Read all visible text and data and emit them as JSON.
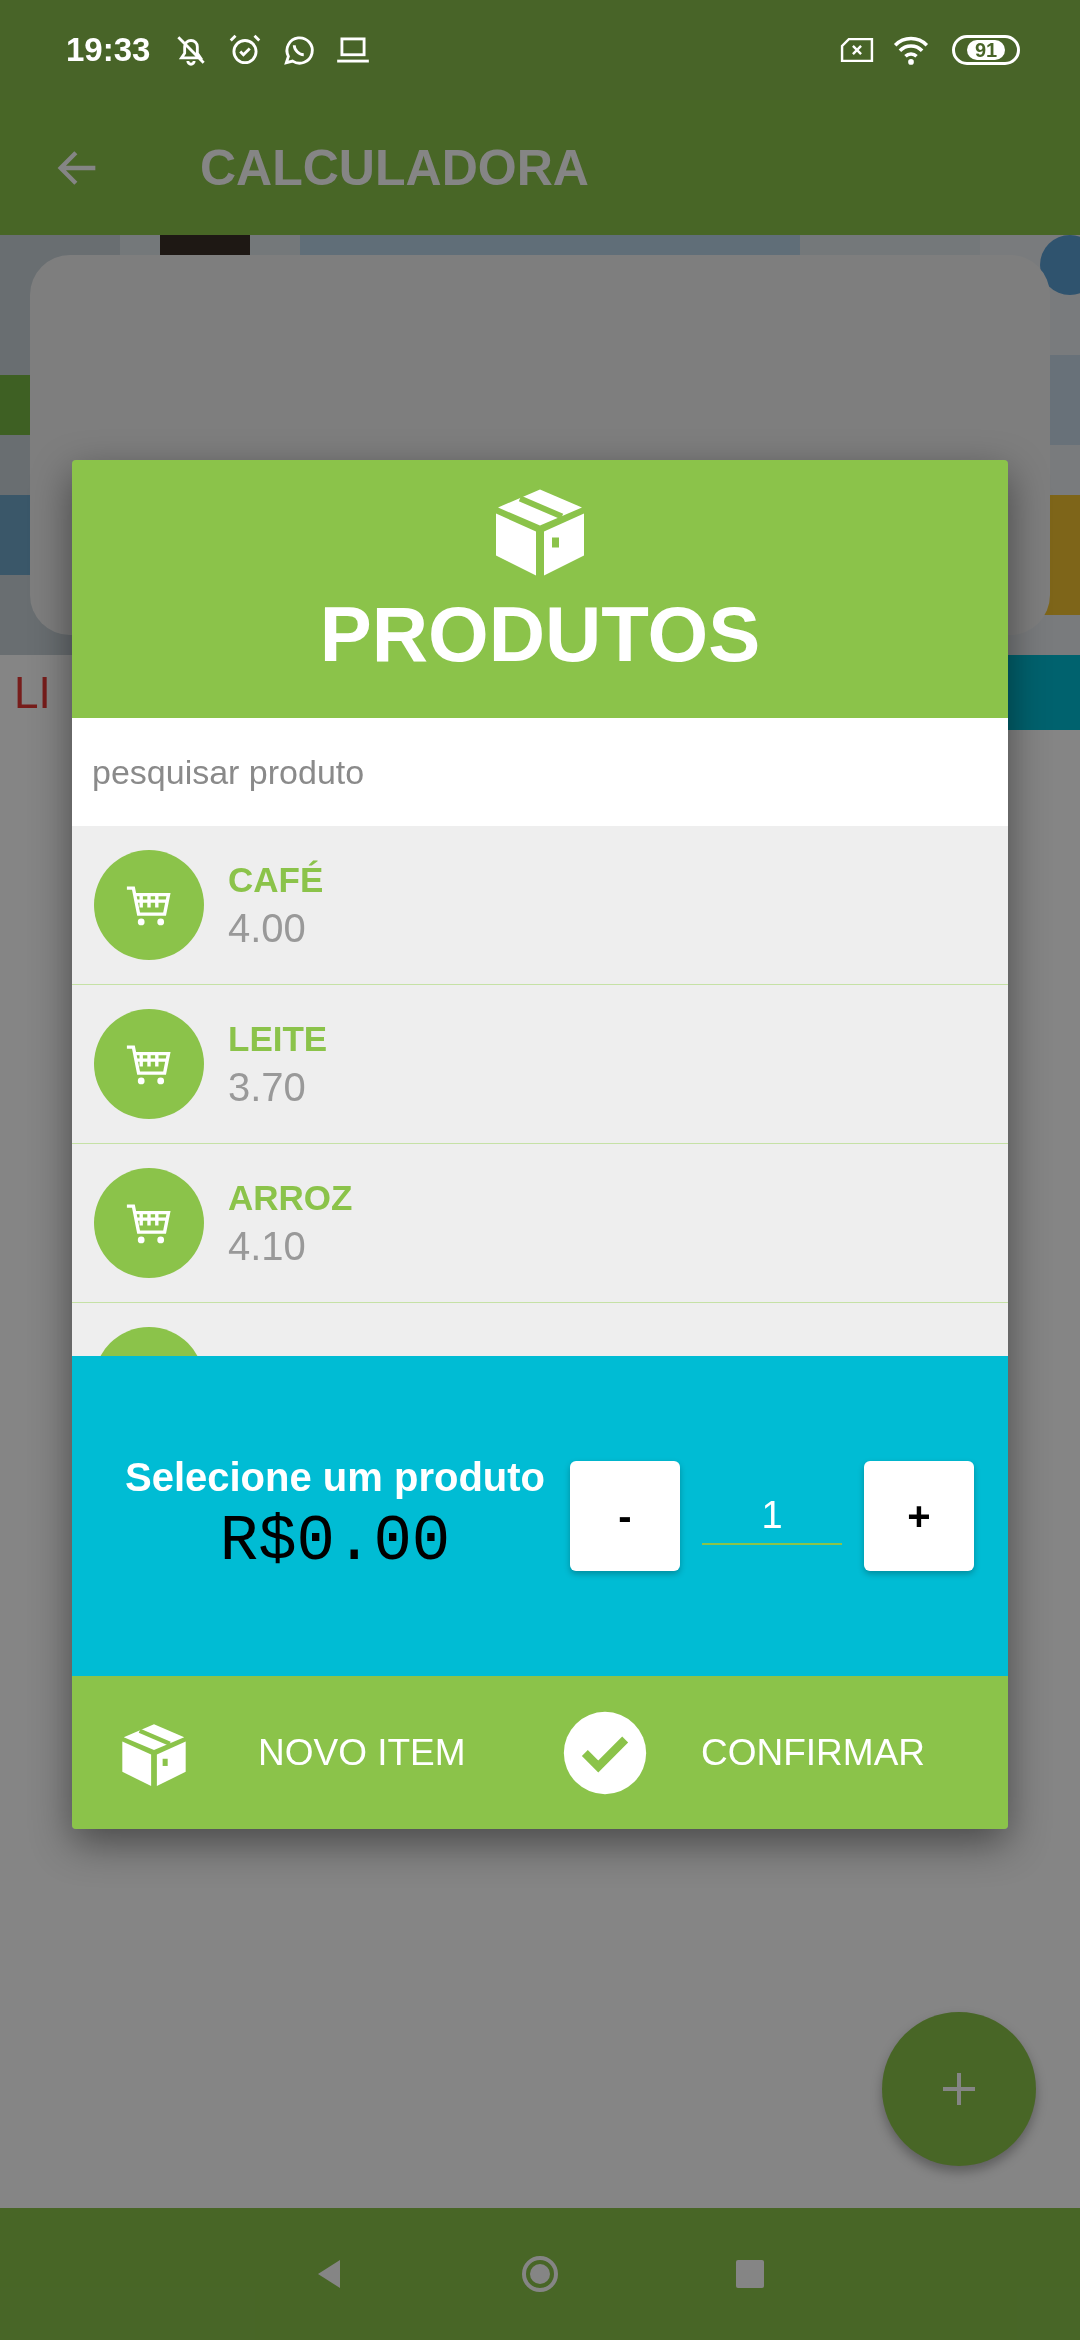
{
  "status_bar": {
    "time": "19:33",
    "battery": "91"
  },
  "app_bar": {
    "title": "CALCULADORA"
  },
  "calculator": {
    "clear_label": "LI"
  },
  "dialog": {
    "title": "PRODUTOS",
    "search": {
      "placeholder": "pesquisar produto"
    },
    "products": [
      {
        "name": "CAFÉ",
        "price": "4.00"
      },
      {
        "name": "LEITE",
        "price": "3.70"
      },
      {
        "name": "ARROZ",
        "price": "4.10"
      }
    ],
    "selection": {
      "label": "Selecione um produto",
      "total": "R$0.00",
      "decrement": "-",
      "quantity": "1",
      "increment": "+"
    },
    "actions": [
      {
        "kind": "new",
        "label": "NOVO ITEM"
      },
      {
        "kind": "confirm",
        "label": "CONFIRMAR"
      }
    ]
  }
}
